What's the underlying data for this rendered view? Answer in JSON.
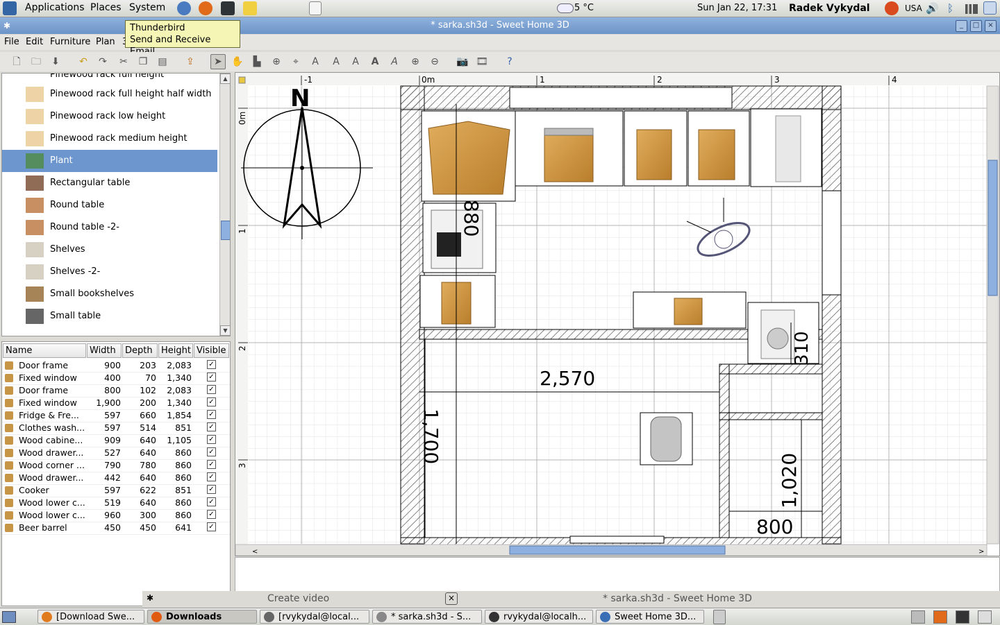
{
  "top_panel": {
    "menus": [
      "Applications",
      "Places",
      "System"
    ],
    "weather": "5 °C",
    "clock": "Sun Jan 22, 17:31",
    "user": "Radek Vykydal",
    "keyboard": "USA"
  },
  "window": {
    "title": "* sarka.sh3d - Sweet Home 3D",
    "menu": [
      "File",
      "Edit",
      "Furniture",
      "Plan",
      "3"
    ]
  },
  "tooltip": {
    "line1": "Thunderbird",
    "line2": "Send and Receive Email"
  },
  "catalog": {
    "partial_top": "Pinewood rack full height",
    "items": [
      {
        "label": "Pinewood rack full height half width",
        "icon": "pinewood-rack-icon"
      },
      {
        "label": "Pinewood rack low height",
        "icon": "pinewood-rack-icon"
      },
      {
        "label": "Pinewood rack medium height",
        "icon": "pinewood-rack-icon"
      },
      {
        "label": "Plant",
        "icon": "plant-icon",
        "selected": true
      },
      {
        "label": "Rectangular table",
        "icon": "table-icon"
      },
      {
        "label": "Round table",
        "icon": "round-table-icon"
      },
      {
        "label": "Round table -2-",
        "icon": "round-table-icon"
      },
      {
        "label": "Shelves",
        "icon": "shelves-icon"
      },
      {
        "label": "Shelves -2-",
        "icon": "shelves-icon"
      },
      {
        "label": "Small bookshelves",
        "icon": "bookshelves-icon"
      },
      {
        "label": "Small table",
        "icon": "small-table-icon"
      }
    ]
  },
  "furniture_table": {
    "columns": [
      "Name",
      "Width",
      "Depth",
      "Height",
      "Visible"
    ],
    "rows": [
      {
        "name": "Door frame",
        "width": "900",
        "depth": "203",
        "height": "2,083"
      },
      {
        "name": "Fixed window",
        "width": "400",
        "depth": "70",
        "height": "1,340"
      },
      {
        "name": "Door frame",
        "width": "800",
        "depth": "102",
        "height": "2,083"
      },
      {
        "name": "Fixed window",
        "width": "1,900",
        "depth": "200",
        "height": "1,340"
      },
      {
        "name": "Fridge & Fre...",
        "width": "597",
        "depth": "660",
        "height": "1,854"
      },
      {
        "name": "Clothes wash...",
        "width": "597",
        "depth": "514",
        "height": "851"
      },
      {
        "name": "Wood cabine...",
        "width": "909",
        "depth": "640",
        "height": "1,105"
      },
      {
        "name": "Wood drawer...",
        "width": "527",
        "depth": "640",
        "height": "860"
      },
      {
        "name": "Wood corner ...",
        "width": "790",
        "depth": "780",
        "height": "860"
      },
      {
        "name": "Wood drawer...",
        "width": "442",
        "depth": "640",
        "height": "860"
      },
      {
        "name": "Cooker",
        "width": "597",
        "depth": "622",
        "height": "851"
      },
      {
        "name": "Wood lower c...",
        "width": "519",
        "depth": "640",
        "height": "860"
      },
      {
        "name": "Wood lower c...",
        "width": "960",
        "depth": "300",
        "height": "860"
      },
      {
        "name": "Beer barrel",
        "width": "450",
        "depth": "450",
        "height": "641"
      }
    ]
  },
  "plan": {
    "ruler_top": [
      "-1",
      "0m",
      "1",
      "2",
      "3",
      "4"
    ],
    "ruler_left": [
      "0m",
      "1",
      "2",
      "3"
    ],
    "compass_label": "N",
    "dimensions": [
      "880",
      "2,570",
      "1,700",
      "1,020",
      "800",
      "310"
    ]
  },
  "dialog_bar": {
    "left": "Create video",
    "right": "* sarka.sh3d - Sweet Home 3D"
  },
  "taskbar": [
    {
      "label": "[Download Swe...",
      "color": "#e07b20"
    },
    {
      "label": "Downloads",
      "color": "#e05a10",
      "active": true
    },
    {
      "label": "[rvykydal@local...",
      "color": "#666666"
    },
    {
      "label": "* sarka.sh3d - S...",
      "color": "#888888"
    },
    {
      "label": "rvykydal@localh...",
      "color": "#333333"
    },
    {
      "label": "Sweet Home 3D...",
      "color": "#3a6fb5"
    }
  ],
  "colors": {
    "selection": "#6d96cf",
    "title_bar": "#7ba0d2",
    "wood": "#c8923e"
  }
}
